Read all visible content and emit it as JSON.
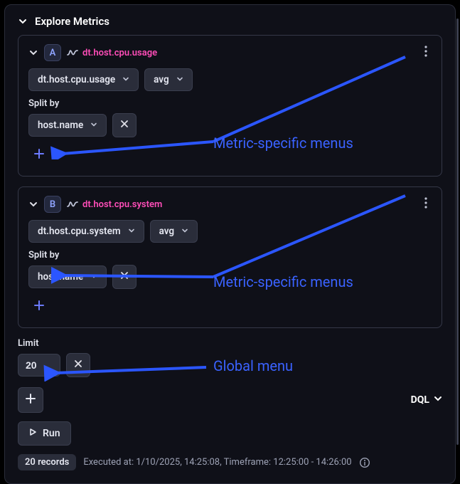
{
  "panel": {
    "title": "Explore Metrics"
  },
  "metrics": [
    {
      "letter": "A",
      "name": "dt.host.cpu.usage",
      "selector": "dt.host.cpu.usage",
      "agg": "avg",
      "split_label": "Split by",
      "split_by": "host.name"
    },
    {
      "letter": "B",
      "name": "dt.host.cpu.system",
      "selector": "dt.host.cpu.system",
      "agg": "avg",
      "split_label": "Split by",
      "split_by": "host.name"
    }
  ],
  "limit": {
    "label": "Limit",
    "value": "20"
  },
  "dql": "DQL",
  "run": "Run",
  "status": {
    "records": "20 records",
    "executed": "Executed at: 1/10/2025, 14:25:08, Timeframe: 12:25:00 - 14:26:00"
  },
  "annotations": {
    "metric_menu": "Metric-specific menus",
    "global_menu": "Global menu"
  }
}
